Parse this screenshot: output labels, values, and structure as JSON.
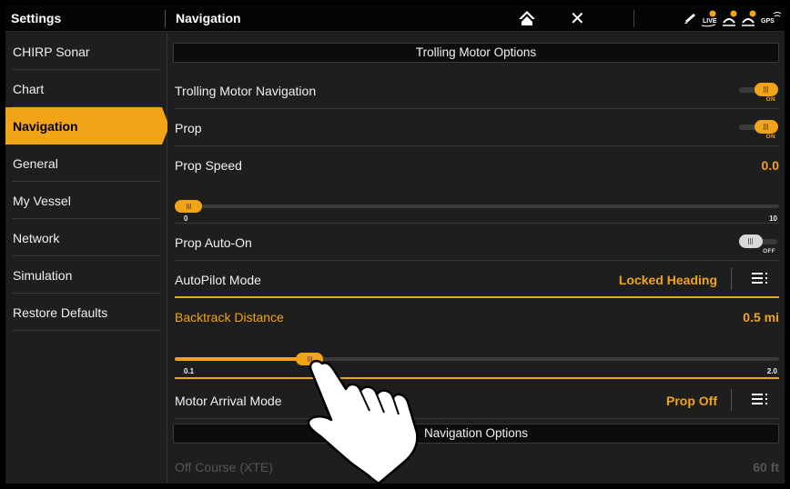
{
  "topbar": {
    "left_title": "Settings",
    "page_title": "Navigation",
    "home_icon": "home-icon",
    "close_icon": "✕",
    "status_icons": [
      "pen-icon",
      "live-icon",
      "sonar-icon",
      "sonar-2-icon",
      "gps-icon"
    ]
  },
  "sidebar": {
    "items": [
      {
        "label": "CHIRP Sonar",
        "active": false
      },
      {
        "label": "Chart",
        "active": false
      },
      {
        "label": "Navigation",
        "active": true
      },
      {
        "label": "General",
        "active": false
      },
      {
        "label": "My Vessel",
        "active": false
      },
      {
        "label": "Network",
        "active": false
      },
      {
        "label": "Simulation",
        "active": false
      },
      {
        "label": "Restore Defaults",
        "active": false
      }
    ]
  },
  "main": {
    "section1": "Trolling Motor Options",
    "trolling_nav": {
      "label": "Trolling Motor Navigation",
      "state": "ON"
    },
    "prop": {
      "label": "Prop",
      "state": "ON"
    },
    "prop_speed": {
      "label": "Prop Speed",
      "value": "0.0",
      "slider_min": "0",
      "slider_max": "10",
      "slider_fraction": 0.0
    },
    "prop_auto_on": {
      "label": "Prop Auto-On",
      "state": "OFF"
    },
    "autopilot_mode": {
      "label": "AutoPilot Mode",
      "value": "Locked Heading"
    },
    "backtrack_distance": {
      "label": "Backtrack Distance",
      "value": "0.5 mi",
      "slider_min": "0.1",
      "slider_max": "2.0",
      "slider_fraction": 0.21
    },
    "motor_arrival_mode": {
      "label": "Motor Arrival Mode",
      "value": "Prop Off"
    },
    "section2": "Navigation Options",
    "off_course": {
      "label": "Off Course (XTE)",
      "value": "60 ft"
    }
  },
  "colors": {
    "accent": "#f2a419",
    "background": "#1e1e1e",
    "topbar": "#050505"
  }
}
